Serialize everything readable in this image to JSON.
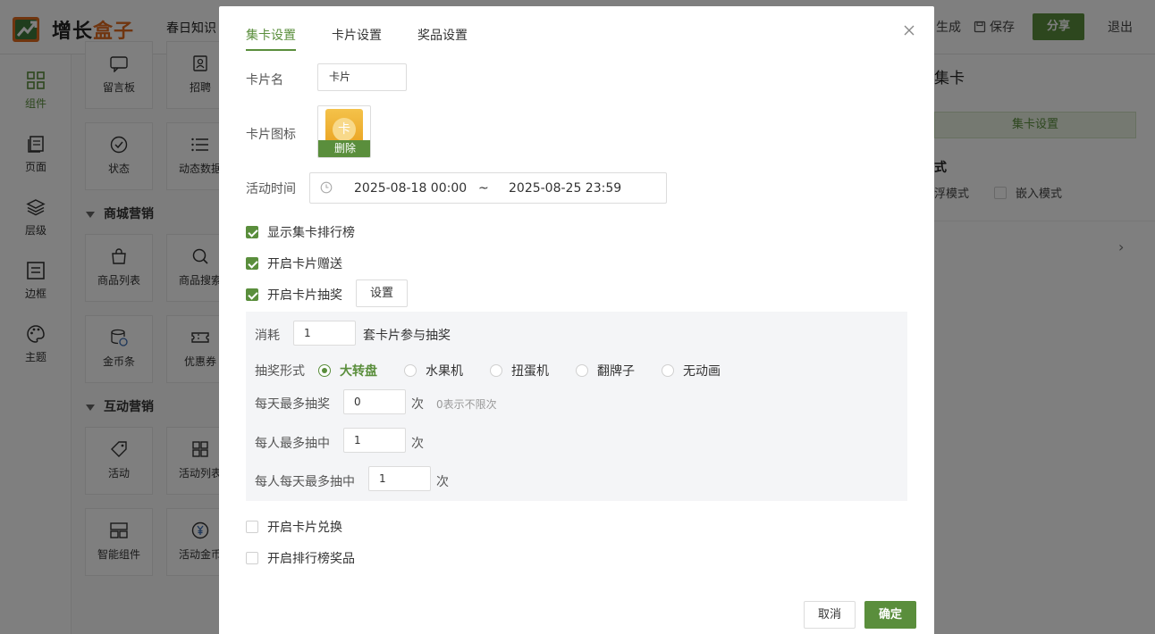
{
  "app": {
    "logo_text_a": "增长",
    "logo_text_b": "盒子",
    "project_title": "春日知识",
    "actions": {
      "generate": "生成",
      "save": "保存",
      "share": "分享",
      "logout": "退出"
    },
    "brand_color": "#5a8e3c"
  },
  "leftnav": {
    "items": [
      {
        "label": "组件",
        "icon": "grid-icon",
        "active": true
      },
      {
        "label": "页面",
        "icon": "pages-icon"
      },
      {
        "label": "层级",
        "icon": "layers-icon"
      },
      {
        "label": "边框",
        "icon": "border-icon"
      },
      {
        "label": "主题",
        "icon": "palette-icon"
      }
    ]
  },
  "palette": {
    "tiles_top": [
      "留言板",
      "招聘",
      "状态",
      "动态数据"
    ],
    "group_mall": "商城营销",
    "tiles_mall": [
      "商品列表",
      "商品搜索",
      "金币条",
      "优惠券"
    ],
    "group_interact": "互动营销",
    "tiles_interact": [
      "活动",
      "活动列表",
      "智能组件",
      "活动金币"
    ]
  },
  "rightpanel": {
    "title": "集卡",
    "tab_button": "集卡设置",
    "section": "式",
    "mode_a": "浮模式",
    "mode_b": "嵌入模式"
  },
  "modal": {
    "tabs": [
      "集卡设置",
      "卡片设置",
      "奖品设置"
    ],
    "card_name_label": "卡片名",
    "card_name_value": "卡片",
    "card_icon_label": "卡片图标",
    "card_icon_glyph": "卡",
    "delete_label": "删除",
    "time_label": "活动时间",
    "time_start": "2025-08-18 00:00",
    "time_sep": "~",
    "time_end": "2025-08-25 23:59",
    "checks": {
      "show_rank": {
        "label": "显示集卡排行榜",
        "checked": true
      },
      "gift": {
        "label": "开启卡片赠送",
        "checked": true
      },
      "lottery": {
        "label": "开启卡片抽奖",
        "checked": true
      },
      "exchange": {
        "label": "开启卡片兑换",
        "checked": false
      },
      "rank_prize": {
        "label": "开启排行榜奖品",
        "checked": false
      }
    },
    "set_button": "设置",
    "lottery": {
      "consume_label": "消耗",
      "consume_value": "1",
      "consume_suffix": "套卡片参与抽奖",
      "form_label": "抽奖形式",
      "forms": [
        "大转盘",
        "水果机",
        "扭蛋机",
        "翻牌子",
        "无动画"
      ],
      "selected_form": "大转盘",
      "daily_max_label": "每天最多抽奖",
      "daily_max_value": "0",
      "unit": "次",
      "daily_hint": "0表示不限次",
      "per_user_label": "每人最多抽中",
      "per_user_value": "1",
      "per_user_daily_label": "每人每天最多抽中",
      "per_user_daily_value": "1"
    },
    "cancel": "取消",
    "confirm": "确定"
  }
}
